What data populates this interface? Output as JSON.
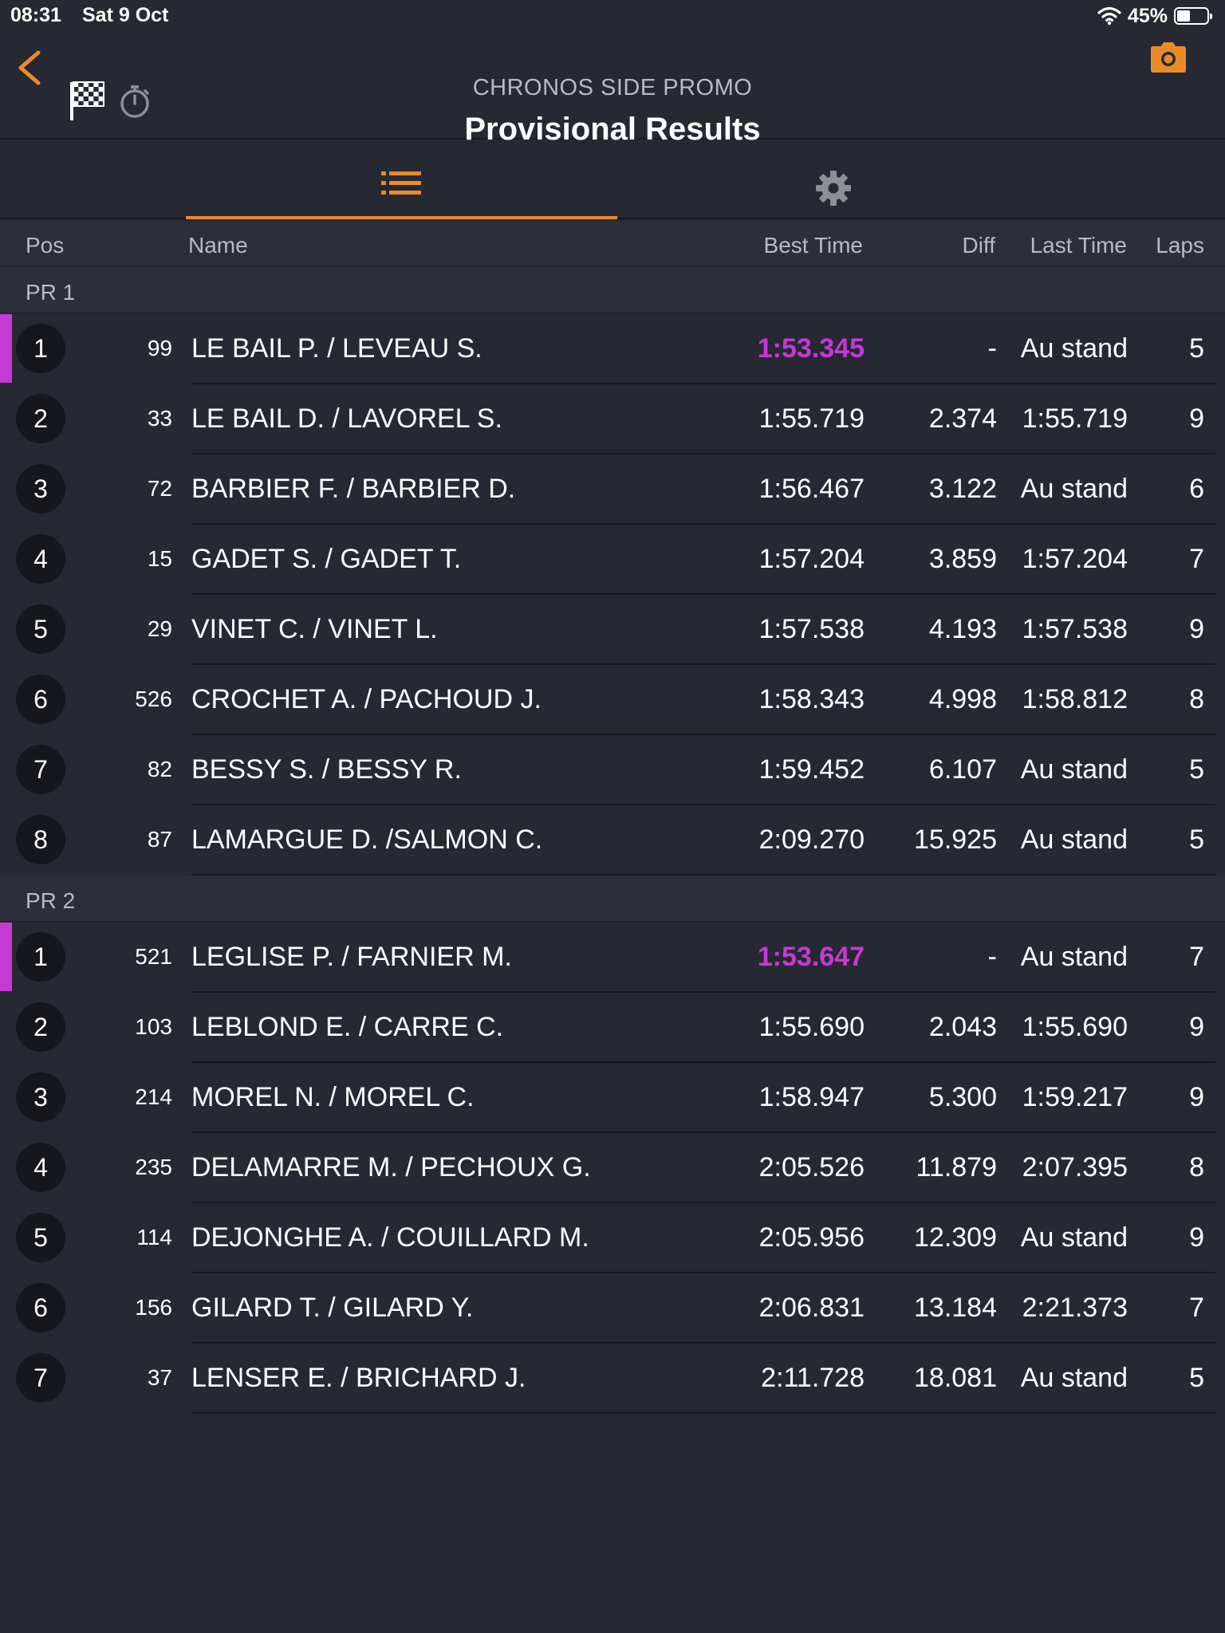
{
  "status_bar": {
    "time": "08:31",
    "date": "Sat 9 Oct",
    "battery": "45%",
    "battery_level": 0.45
  },
  "header": {
    "subtitle": "CHRONOS SIDE PROMO",
    "title": "Provisional Results",
    "icons": [
      "back-chevron-icon",
      "checkered-flag-icon",
      "stopwatch-icon",
      "camera-icon"
    ]
  },
  "tabs": [
    {
      "name": "results-list",
      "icon": "list-icon",
      "active": true
    },
    {
      "name": "settings",
      "icon": "gear-icon",
      "active": false
    }
  ],
  "columns": {
    "pos": "Pos",
    "name": "Name",
    "best_time": "Best Time",
    "diff": "Diff",
    "last_time": "Last Time",
    "laps": "Laps"
  },
  "colors": {
    "accent": "#ea8b2a",
    "fastest": "#c63ad4",
    "background": "#262832"
  },
  "groups": [
    {
      "label": "PR 1",
      "rows": [
        {
          "pos": "1",
          "num": "99",
          "name": "LE BAIL P. / LEVEAU S.",
          "best": "1:53.345",
          "diff": "-",
          "last": "Au stand",
          "laps": "5",
          "fastest": true
        },
        {
          "pos": "2",
          "num": "33",
          "name": "LE BAIL D. / LAVOREL S.",
          "best": "1:55.719",
          "diff": "2.374",
          "last": "1:55.719",
          "laps": "9",
          "fastest": false
        },
        {
          "pos": "3",
          "num": "72",
          "name": "BARBIER F. / BARBIER D.",
          "best": "1:56.467",
          "diff": "3.122",
          "last": "Au stand",
          "laps": "6",
          "fastest": false
        },
        {
          "pos": "4",
          "num": "15",
          "name": "GADET S. / GADET T.",
          "best": "1:57.204",
          "diff": "3.859",
          "last": "1:57.204",
          "laps": "7",
          "fastest": false
        },
        {
          "pos": "5",
          "num": "29",
          "name": "VINET C. / VINET L.",
          "best": "1:57.538",
          "diff": "4.193",
          "last": "1:57.538",
          "laps": "9",
          "fastest": false
        },
        {
          "pos": "6",
          "num": "526",
          "name": "CROCHET A. / PACHOUD J.",
          "best": "1:58.343",
          "diff": "4.998",
          "last": "1:58.812",
          "laps": "8",
          "fastest": false
        },
        {
          "pos": "7",
          "num": "82",
          "name": "BESSY S. / BESSY R.",
          "best": "1:59.452",
          "diff": "6.107",
          "last": "Au stand",
          "laps": "5",
          "fastest": false
        },
        {
          "pos": "8",
          "num": "87",
          "name": "LAMARGUE D. /SALMON C.",
          "best": "2:09.270",
          "diff": "15.925",
          "last": "Au stand",
          "laps": "5",
          "fastest": false
        }
      ]
    },
    {
      "label": "PR 2",
      "rows": [
        {
          "pos": "1",
          "num": "521",
          "name": "LEGLISE P. / FARNIER M.",
          "best": "1:53.647",
          "diff": "-",
          "last": "Au stand",
          "laps": "7",
          "fastest": true
        },
        {
          "pos": "2",
          "num": "103",
          "name": "LEBLOND E. / CARRE C.",
          "best": "1:55.690",
          "diff": "2.043",
          "last": "1:55.690",
          "laps": "9",
          "fastest": false
        },
        {
          "pos": "3",
          "num": "214",
          "name": "MOREL N. / MOREL C.",
          "best": "1:58.947",
          "diff": "5.300",
          "last": "1:59.217",
          "laps": "9",
          "fastest": false
        },
        {
          "pos": "4",
          "num": "235",
          "name": "DELAMARRE M. / PECHOUX G.",
          "best": "2:05.526",
          "diff": "11.879",
          "last": "2:07.395",
          "laps": "8",
          "fastest": false
        },
        {
          "pos": "5",
          "num": "114",
          "name": "DEJONGHE A. / COUILLARD M.",
          "best": "2:05.956",
          "diff": "12.309",
          "last": "Au stand",
          "laps": "9",
          "fastest": false
        },
        {
          "pos": "6",
          "num": "156",
          "name": "GILARD T. / GILARD Y.",
          "best": "2:06.831",
          "diff": "13.184",
          "last": "2:21.373",
          "laps": "7",
          "fastest": false
        },
        {
          "pos": "7",
          "num": "37",
          "name": "LENSER E. / BRICHARD J.",
          "best": "2:11.728",
          "diff": "18.081",
          "last": "Au stand",
          "laps": "5",
          "fastest": false
        }
      ]
    }
  ]
}
